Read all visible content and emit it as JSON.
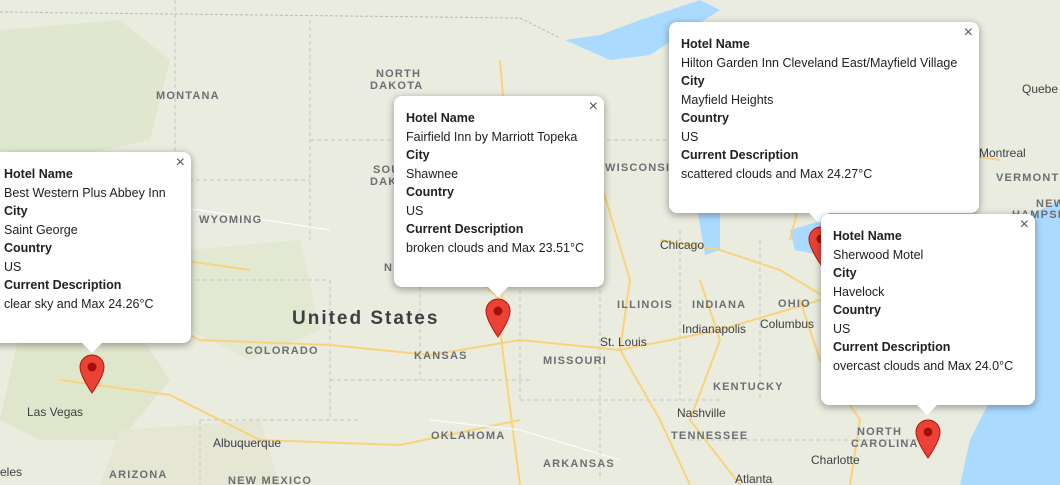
{
  "map": {
    "country_label": "United States",
    "state_labels": [
      {
        "id": "montana",
        "text": "MONTANA"
      },
      {
        "id": "north-dakota-1",
        "text": "NORTH"
      },
      {
        "id": "north-dakota-2",
        "text": "DAKOTA"
      },
      {
        "id": "south-dakota-1",
        "text": "SOUTH"
      },
      {
        "id": "south-dakota-2",
        "text": "DAKOTA"
      },
      {
        "id": "wyoming",
        "text": "WYOMING"
      },
      {
        "id": "nebraska",
        "text": "N"
      },
      {
        "id": "colorado",
        "text": "COLORADO"
      },
      {
        "id": "kansas",
        "text": "KANSAS"
      },
      {
        "id": "missouri",
        "text": "MISSOURI"
      },
      {
        "id": "illinois",
        "text": "ILLINOIS"
      },
      {
        "id": "indiana",
        "text": "INDIANA"
      },
      {
        "id": "ohio",
        "text": "OHIO"
      },
      {
        "id": "kentucky",
        "text": "KENTUCKY"
      },
      {
        "id": "tennessee",
        "text": "TENNESSEE"
      },
      {
        "id": "oklahoma",
        "text": "OKLAHOMA"
      },
      {
        "id": "arkansas",
        "text": "ARKANSAS"
      },
      {
        "id": "arizona",
        "text": "ARIZONA"
      },
      {
        "id": "new-mexico",
        "text": "NEW MEXICO"
      },
      {
        "id": "wisconsin",
        "text": "WISCONSIN"
      },
      {
        "id": "north-carolina-1",
        "text": "NORTH"
      },
      {
        "id": "north-carolina-2",
        "text": "CAROLINA"
      },
      {
        "id": "vermont",
        "text": "VERMONT"
      },
      {
        "id": "new-hampshire-1",
        "text": "NEW"
      },
      {
        "id": "new-hampshire-2",
        "text": "HAMPSHI"
      }
    ],
    "city_labels": [
      {
        "id": "chicago",
        "text": "Chicago"
      },
      {
        "id": "indianapolis",
        "text": "Indianapolis"
      },
      {
        "id": "columbus",
        "text": "Columbus"
      },
      {
        "id": "st-louis",
        "text": "St. Louis"
      },
      {
        "id": "nashville",
        "text": "Nashville"
      },
      {
        "id": "las-vegas",
        "text": "Las Vegas"
      },
      {
        "id": "albuquerque",
        "text": "Albuquerque"
      },
      {
        "id": "charlotte",
        "text": "Charlotte"
      },
      {
        "id": "atlanta",
        "text": "Atlanta"
      },
      {
        "id": "montreal",
        "text": "Montreal"
      },
      {
        "id": "quebec",
        "text": "Quebe"
      },
      {
        "id": "los-angeles",
        "text": "eles"
      }
    ]
  },
  "hotel_popups": [
    {
      "id": "popup-saint-george",
      "hotel_label": "Hotel Name",
      "hotel_name": "Best Western Plus Abbey Inn",
      "city_label": "City",
      "city": "Saint George",
      "country_label": "Country",
      "country": "US",
      "description_label": "Current Description",
      "description": "clear sky and Max 24.26°C"
    },
    {
      "id": "popup-shawnee",
      "hotel_label": "Hotel Name",
      "hotel_name": "Fairfield Inn by Marriott Topeka",
      "city_label": "City",
      "city": "Shawnee",
      "country_label": "Country",
      "country": "US",
      "description_label": "Current Description",
      "description": "broken clouds and Max 23.51°C"
    },
    {
      "id": "popup-mayfield-heights",
      "hotel_label": "Hotel Name",
      "hotel_name": "Hilton Garden Inn Cleveland East/Mayfield Village",
      "city_label": "City",
      "city": "Mayfield Heights",
      "country_label": "Country",
      "country": "US",
      "description_label": "Current Description",
      "description": "scattered clouds and Max 24.27°C"
    },
    {
      "id": "popup-havelock",
      "hotel_label": "Hotel Name",
      "hotel_name": "Sherwood Motel",
      "city_label": "City",
      "city": "Havelock",
      "country_label": "Country",
      "country": "US",
      "description_label": "Current Description",
      "description": "overcast clouds and Max 24.0°C"
    }
  ],
  "close_glyph": "×",
  "colors": {
    "land": "#e9ecdf",
    "water": "#aadaff",
    "marker": "#ea4335",
    "highway": "#f9d37c"
  }
}
